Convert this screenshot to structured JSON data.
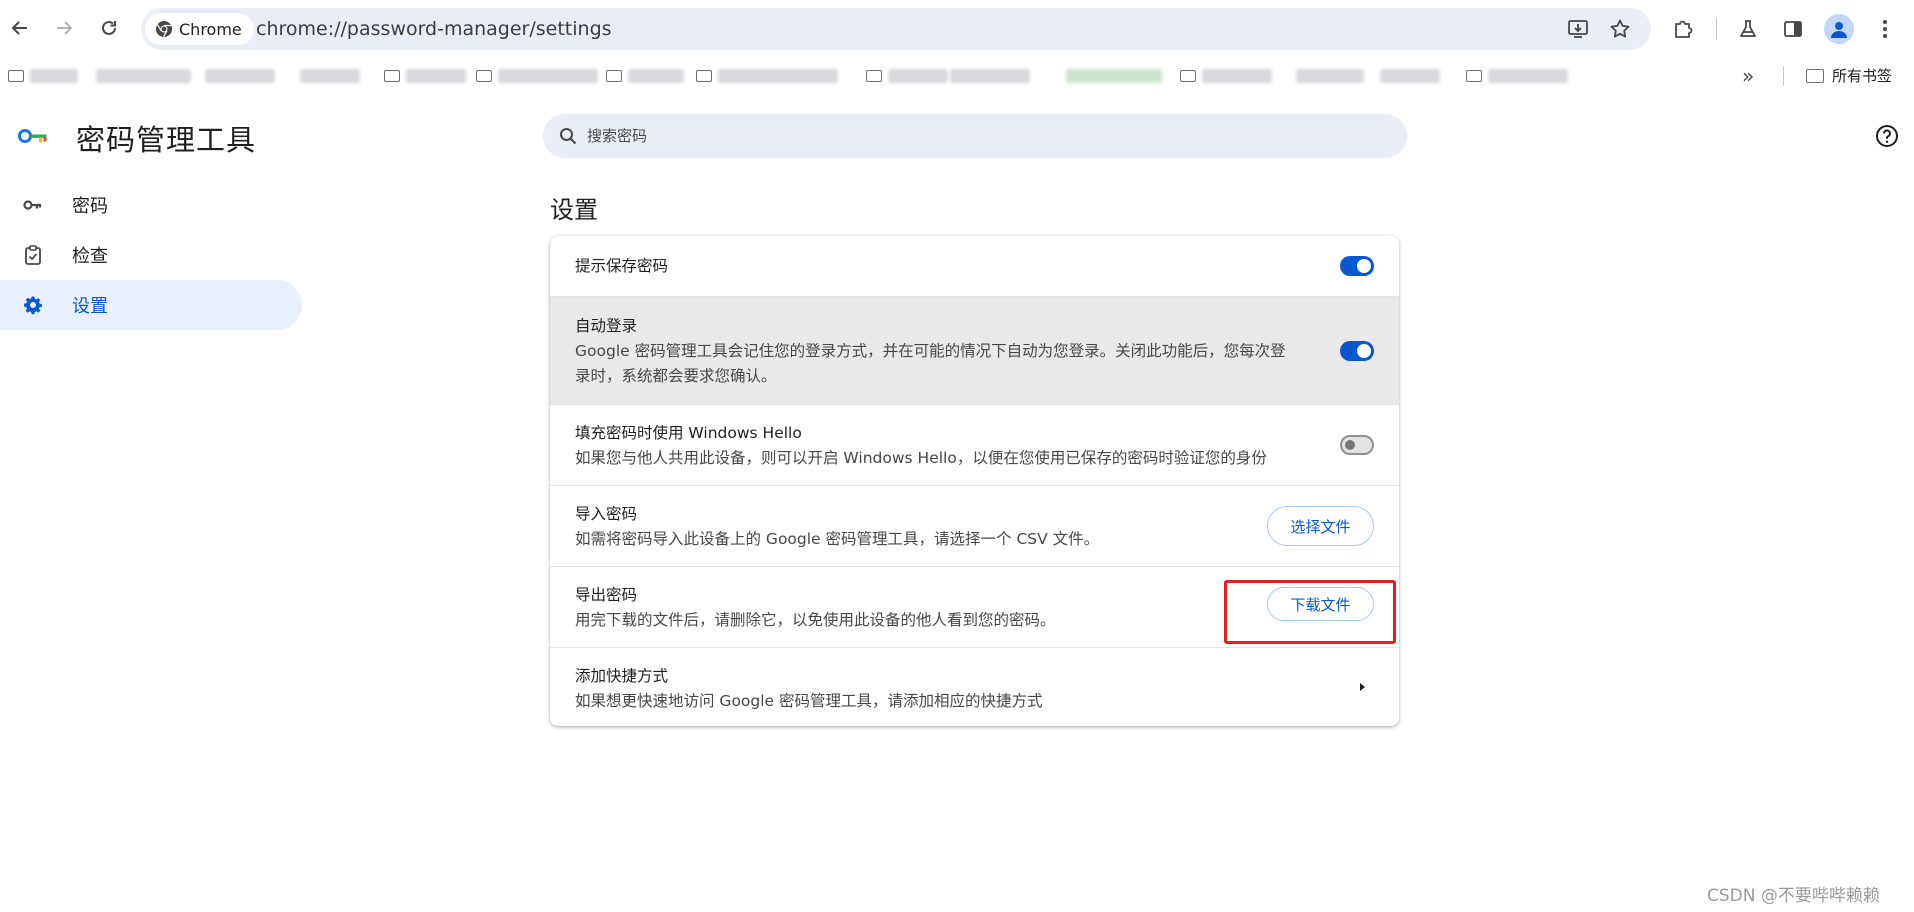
{
  "browser": {
    "chip_label": "Chrome",
    "url": "chrome://password-manager/settings",
    "bookmarks_all_label": "所有书签",
    "bookmarks_more": "»"
  },
  "sidebar": {
    "app_title": "密码管理工具",
    "items": [
      {
        "label": "密码",
        "icon": "key-icon",
        "active": false
      },
      {
        "label": "检查",
        "icon": "checkup-icon",
        "active": false
      },
      {
        "label": "设置",
        "icon": "gear-icon",
        "active": true
      }
    ]
  },
  "search": {
    "placeholder": "搜索密码"
  },
  "settings": {
    "section_title": "设置",
    "rows": [
      {
        "title": "提示保存密码",
        "control": "toggle",
        "state": "on"
      },
      {
        "title": "自动登录",
        "description": "Google 密码管理工具会记住您的登录方式，并在可能的情况下自动为您登录。关闭此功能后，您每次登录时，系统都会要求您确认。",
        "control": "toggle",
        "state": "on"
      },
      {
        "title": "填充密码时使用 Windows Hello",
        "description": "如果您与他人共用此设备，则可以开启 Windows Hello，以便在您使用已保存的密码时验证您的身份",
        "control": "toggle",
        "state": "off"
      },
      {
        "title": "导入密码",
        "description": "如需将密码导入此设备上的 Google 密码管理工具，请选择一个 CSV 文件。",
        "control": "button",
        "button_label": "选择文件"
      },
      {
        "title": "导出密码",
        "description": "用完下载的文件后，请删除它，以免使用此设备的他人看到您的密码。",
        "control": "button",
        "button_label": "下载文件"
      },
      {
        "title": "添加快捷方式",
        "description": "如果想更快速地访问 Google 密码管理工具，请添加相应的快捷方式",
        "control": "arrow"
      }
    ]
  },
  "watermark": "CSDN @不要哔哔赖赖",
  "colors": {
    "accent": "#0b57d0",
    "highlight": "#e01f1f",
    "active_bg": "#e8f0fe"
  }
}
